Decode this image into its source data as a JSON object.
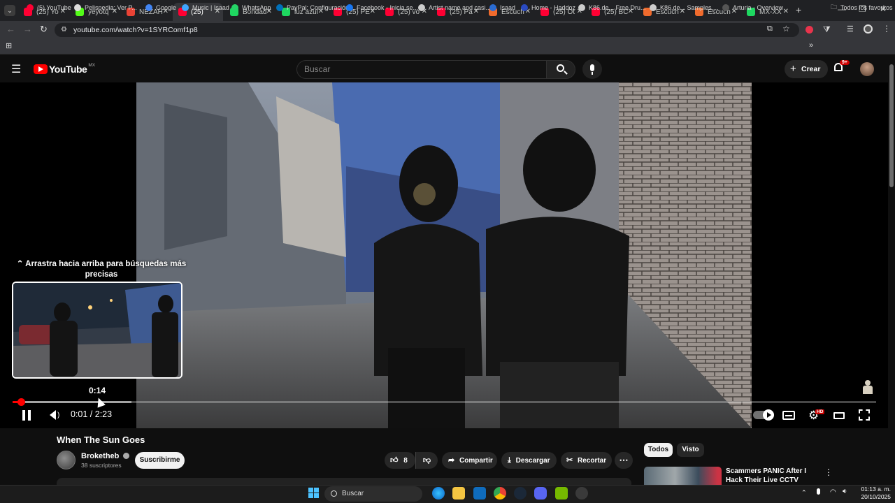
{
  "browser": {
    "tabs": [
      {
        "title": "(25) Yo",
        "color": "#ff0033",
        "active": false
      },
      {
        "title": "yeyotq",
        "color": "#53fc18",
        "active": false
      },
      {
        "title": "NEZAH",
        "color": "#ea4335",
        "active": false
      },
      {
        "title": "(25)",
        "color": "#ff0033",
        "active": true
      },
      {
        "title": "Bondad",
        "color": "#1ed760",
        "active": false
      },
      {
        "title": "luz azul",
        "color": "#1ed760",
        "active": false
      },
      {
        "title": "(25) PE",
        "color": "#ff0033",
        "active": false
      },
      {
        "title": "(25) vo",
        "color": "#ff0033",
        "active": false
      },
      {
        "title": "(25) Pa",
        "color": "#ff0033",
        "active": false
      },
      {
        "title": "Escuch",
        "color": "#f06b2d",
        "active": false
      },
      {
        "title": "(25) Ot",
        "color": "#ff0033",
        "active": false
      },
      {
        "title": "(25) BC",
        "color": "#ff0033",
        "active": false
      },
      {
        "title": "Escuch",
        "color": "#f06b2d",
        "active": false
      },
      {
        "title": "Escuch",
        "color": "#f06b2d",
        "active": false
      },
      {
        "title": "MX-XX",
        "color": "#1ed760",
        "active": false
      }
    ],
    "new_tab": "+",
    "url": "youtube.com/watch?v=1SYRComf1p8",
    "bookmarks": [
      {
        "label": "(5) YouTube",
        "color": "#ff0033"
      },
      {
        "label": "Pelispedia: Ver P...",
        "color": "#dddddd"
      },
      {
        "label": "Google",
        "color": "#4285f4"
      },
      {
        "label": "Music | Isaad",
        "color": "#3ea6ff"
      },
      {
        "label": "WhatsApp",
        "color": "#25d366"
      },
      {
        "label": "PayPal: Configuración",
        "color": "#0070ba"
      },
      {
        "label": "Facebook - Inicia se...",
        "color": "#1877f2"
      },
      {
        "label": "Artist name and casi...",
        "color": "#cccccc"
      },
      {
        "label": "Isaad",
        "color": "#2a6bd1"
      },
      {
        "label": "Home - Haddoz",
        "color": "#2a4ac1"
      },
      {
        "label": "K86.de... Free Dru...",
        "color": "#cccccc"
      },
      {
        "label": "K86.de... Samples,...",
        "color": "#cccccc"
      },
      {
        "label": "Arturia - Overview",
        "color": "#555555"
      }
    ],
    "all_bookmarks": "Todos los favoritos"
  },
  "youtube": {
    "logo_text": "YouTube",
    "country": "MX",
    "search_placeholder": "Buscar",
    "create_label": "Crear",
    "notifications_badge": "9+"
  },
  "player": {
    "preview_hint": "Arrastra hacia arriba para búsquedas más precisas",
    "preview_time": "0:14",
    "current_time": "0:01 / 2:23",
    "played_fraction": 0.0095,
    "buffered_fraction": 0.138,
    "hover_fraction": 0.098,
    "hd_badge": "HD"
  },
  "video": {
    "title": "When The Sun Goes",
    "channel": "Broketheb",
    "subscribers": "38 suscriptores",
    "subscribe_label": "Suscribirme",
    "likes": "8",
    "share_label": "Compartir",
    "download_label": "Descargar",
    "clip_label": "Recortar"
  },
  "recommendations": {
    "chips": [
      "Todos",
      "Visto"
    ],
    "first_title": "Scammers PANIC After I Hack Their Live CCTV Cameras!"
  },
  "taskbar": {
    "search_label": "Buscar",
    "time": "01:13 a. m.",
    "date": "20/10/2025"
  }
}
